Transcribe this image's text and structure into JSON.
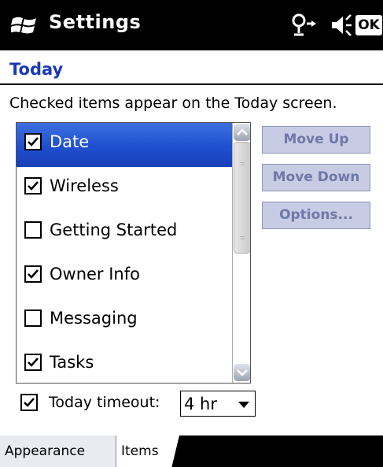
{
  "titlebar": {
    "title": "Settings",
    "icons": [
      "windows-flag-icon",
      "connectivity-icon",
      "volume-icon"
    ],
    "ok_label": "OK"
  },
  "header": {
    "title": "Today"
  },
  "hint": "Checked items appear on the Today screen.",
  "list": {
    "items": [
      {
        "label": "Date",
        "checked": true,
        "selected": true
      },
      {
        "label": "Wireless",
        "checked": true,
        "selected": false
      },
      {
        "label": "Getting Started",
        "checked": false,
        "selected": false
      },
      {
        "label": "Owner Info",
        "checked": true,
        "selected": false
      },
      {
        "label": "Messaging",
        "checked": false,
        "selected": false
      },
      {
        "label": "Tasks",
        "checked": true,
        "selected": false
      }
    ]
  },
  "buttons": {
    "move_up": "Move Up",
    "move_down": "Move Down",
    "options": "Options..."
  },
  "timeout": {
    "label": "Today timeout:",
    "checked": true,
    "value": "4 hr"
  },
  "tabs": {
    "appearance": "Appearance",
    "items": "Items"
  },
  "colors": {
    "accent": "#1b39b8",
    "selection": "#2150d4",
    "disabled_button": "#c7cce4"
  }
}
